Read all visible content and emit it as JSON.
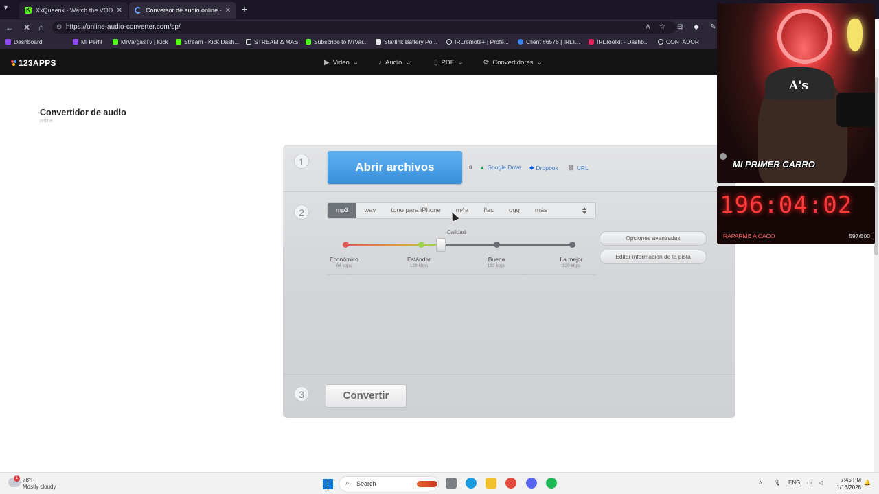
{
  "browser": {
    "tabs": [
      {
        "title": "XxQueenx - Watch the VOD on Ki"
      },
      {
        "title": "Conversor de audio online - Conv"
      }
    ],
    "url": "https://online-audio-converter.com/sp/",
    "bookmarks": [
      {
        "label": "Dashboard"
      },
      {
        "label": "Mi Perfil"
      },
      {
        "label": "MrVargasTv | Kick"
      },
      {
        "label": "Stream - Kick Dash..."
      },
      {
        "label": "STREAM & MAS"
      },
      {
        "label": "Subscribe to MrVar..."
      },
      {
        "label": "Starlink Battery Po..."
      },
      {
        "label": "IRLremote+ | Profe..."
      },
      {
        "label": "Client #6576 | IRLT..."
      },
      {
        "label": "IRLToolkit - Dashb..."
      },
      {
        "label": "CONTADOR"
      }
    ]
  },
  "site": {
    "logo": "123APPS",
    "menu": [
      {
        "label": "Video"
      },
      {
        "label": "Audio"
      },
      {
        "label": "PDF"
      },
      {
        "label": "Convertidores"
      }
    ]
  },
  "page": {
    "title": "Convertidor de audio",
    "subtitle": "online"
  },
  "converter": {
    "steps": [
      "1",
      "2",
      "3"
    ],
    "open_button": "Abrir archivos",
    "or_text": "o",
    "sources": [
      {
        "label": "Google Drive"
      },
      {
        "label": "Dropbox"
      },
      {
        "label": "URL"
      }
    ],
    "formats": [
      "mp3",
      "wav",
      "tono para iPhone",
      "m4a",
      "flac",
      "ogg",
      "más"
    ],
    "selected_format": "mp3",
    "quality_label": "Calidad",
    "quality_levels": [
      {
        "name": "Económico",
        "bitrate": "64 kbps"
      },
      {
        "name": "Estándar",
        "bitrate": "128 kbps"
      },
      {
        "name": "Buena",
        "bitrate": "192 kbps"
      },
      {
        "name": "La mejor",
        "bitrate": "320 kbps"
      }
    ],
    "selected_quality": "Estándar",
    "advanced_button": "Opciones avanzadas",
    "edit_track_button": "Editar información de la pista",
    "convert_button": "Convertir"
  },
  "overlay": {
    "webcam_text": "MI PRIMER CARRO",
    "cap_logo": "A's",
    "timer": "196:04:02",
    "timer_label": "RAPARME A CACO",
    "counter": "597/500"
  },
  "taskbar": {
    "weather_badge": "1",
    "temperature": "78°F",
    "weather_desc": "Mostly cloudy",
    "search_label": "Search",
    "lang": "ENG",
    "time": "7:45 PM",
    "date": "1/16/2026"
  }
}
